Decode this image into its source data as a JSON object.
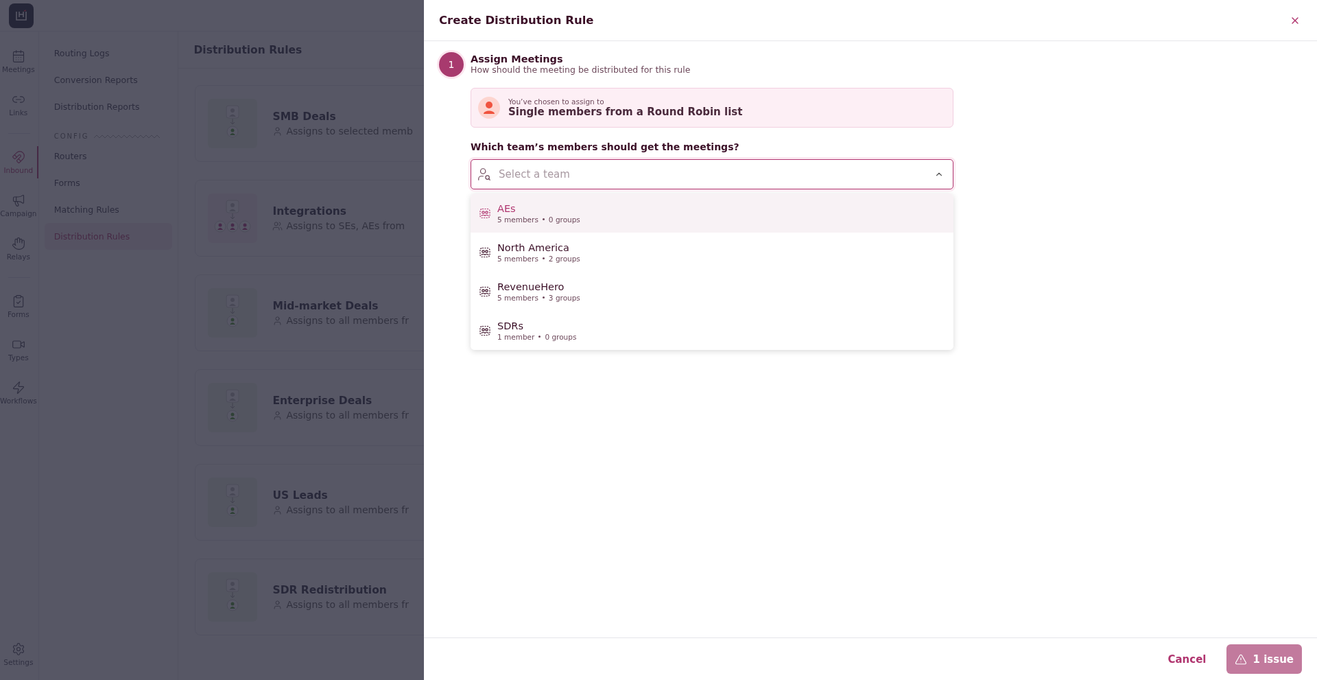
{
  "rail": {
    "groups": [
      [
        {
          "label": "Meetings",
          "selected": false
        },
        {
          "label": "Links",
          "selected": false
        }
      ],
      [
        {
          "label": "Inbound",
          "selected": true
        },
        {
          "label": "Campaign",
          "selected": false
        },
        {
          "label": "Relays",
          "selected": false
        }
      ],
      [
        {
          "label": "Forms",
          "selected": false
        },
        {
          "label": "Types",
          "selected": false
        },
        {
          "label": "Workflows",
          "selected": false
        }
      ]
    ],
    "footer": {
      "label": "Settings",
      "selected": false
    }
  },
  "nav": {
    "items": [
      {
        "label": "Routing Logs",
        "selected": false
      },
      {
        "label": "Conversion Reports",
        "selected": false
      },
      {
        "label": "Distribution Reports",
        "selected": false
      }
    ],
    "section": "CONFIG",
    "config_items": [
      {
        "label": "Routers",
        "selected": false
      },
      {
        "label": "Forms",
        "selected": false
      },
      {
        "label": "Matching Rules",
        "selected": false
      },
      {
        "label": "Distribution Rules",
        "selected": true
      }
    ]
  },
  "main": {
    "title": "Distribution Rules",
    "rules": [
      {
        "name": "SMB Deals",
        "description": "Assigns to selected memb",
        "kind": "single"
      },
      {
        "name": "Integrations",
        "description": "Assigns to SEs, AEs from",
        "kind": "team"
      },
      {
        "name": "Mid-market Deals",
        "description": "Assigns to all members fr",
        "kind": "single"
      },
      {
        "name": "Enterprise Deals",
        "description": "Assigns to all members fr",
        "kind": "single"
      },
      {
        "name": "US Leads",
        "description": "Assigns to all members fr",
        "kind": "single"
      },
      {
        "name": "SDR Redistribution",
        "description": "Assigns to all members fr",
        "kind": "single"
      }
    ]
  },
  "drawer": {
    "title": "Create Distribution Rule",
    "step": {
      "number": "1",
      "title": "Assign Meetings",
      "subtitle": "How should the meeting be distributed for this rule"
    },
    "choice": {
      "caption": "You’ve chosen to assign to",
      "value": "Single members from a Round Robin list"
    },
    "question": "Which team’s members should get the meetings?",
    "select": {
      "placeholder": "Select a team",
      "expanded": true
    },
    "options": [
      {
        "name": "AEs",
        "members": "5 members",
        "groups": "0 groups",
        "selected": true
      },
      {
        "name": "North America",
        "members": "5 members",
        "groups": "2 groups",
        "selected": false
      },
      {
        "name": "RevenueHero",
        "members": "5 members",
        "groups": "3 groups",
        "selected": false
      },
      {
        "name": "SDRs",
        "members": "1 member",
        "groups": "0 groups",
        "selected": false
      }
    ],
    "footer": {
      "cancel": "Cancel",
      "submit": "1 issue",
      "disabled": true
    }
  }
}
